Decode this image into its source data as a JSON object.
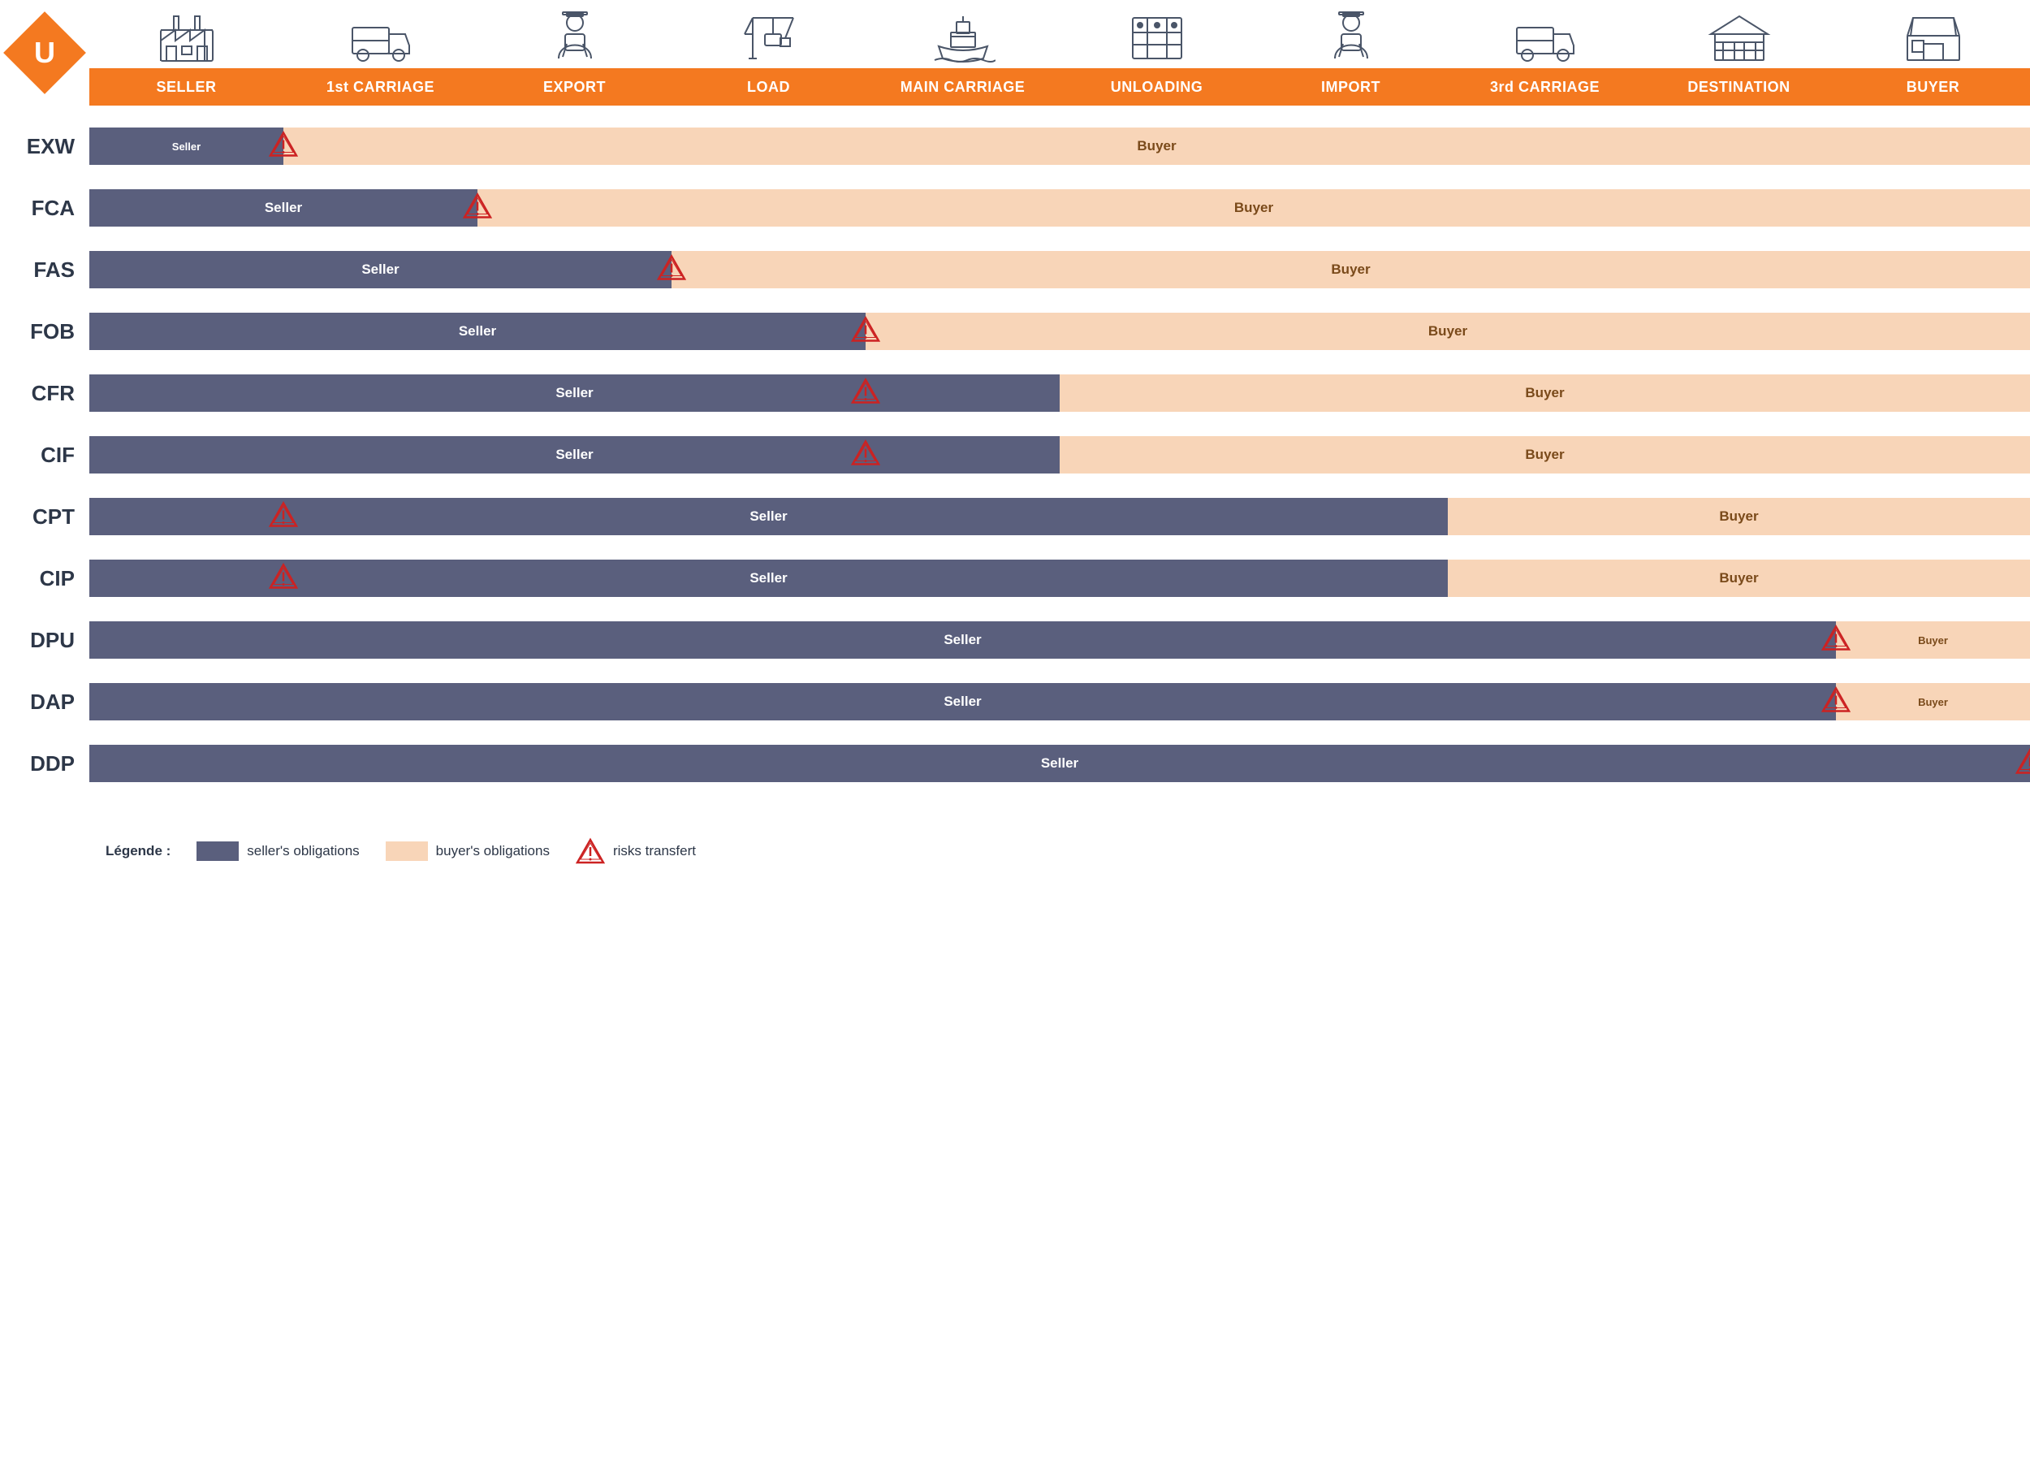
{
  "header": {
    "columns": [
      {
        "label": "SELLER",
        "icon": "factory"
      },
      {
        "label": "1st CARRIAGE",
        "icon": "truck"
      },
      {
        "label": "EXPORT",
        "icon": "person"
      },
      {
        "label": "LOAD",
        "icon": "crane"
      },
      {
        "label": "MAIN\nCARRIAGE",
        "icon": "ship"
      },
      {
        "label": "UNLOADING",
        "icon": "grid-box"
      },
      {
        "label": "IMPORT",
        "icon": "person2"
      },
      {
        "label": "3rd CARRIAGE",
        "icon": "truck2"
      },
      {
        "label": "DESTINATION",
        "icon": "warehouse"
      },
      {
        "label": "BUYER",
        "icon": "shop"
      }
    ]
  },
  "incoterms": [
    {
      "code": "EXW",
      "seller_cols": 1,
      "risk_at": 1,
      "buyer_cols": 9
    },
    {
      "code": "FCA",
      "seller_cols": 2,
      "risk_at": 2,
      "buyer_cols": 8
    },
    {
      "code": "FAS",
      "seller_cols": 3,
      "risk_at": 3,
      "buyer_cols": 7
    },
    {
      "code": "FOB",
      "seller_cols": 4,
      "risk_at": 4,
      "buyer_cols": 6
    },
    {
      "code": "CFR",
      "seller_cols": 5,
      "risk_at": 4,
      "buyer_cols": 5
    },
    {
      "code": "CIF",
      "seller_cols": 5,
      "risk_at": 4,
      "buyer_cols": 5
    },
    {
      "code": "CPT",
      "seller_cols": 7,
      "risk_at": 1,
      "buyer_cols": 3
    },
    {
      "code": "CIP",
      "seller_cols": 7,
      "risk_at": 1,
      "buyer_cols": 3
    },
    {
      "code": "DPU",
      "seller_cols": 9,
      "risk_at": 9,
      "buyer_cols": 1
    },
    {
      "code": "DAP",
      "seller_cols": 9,
      "risk_at": 9,
      "buyer_cols": 1
    },
    {
      "code": "DDP",
      "seller_cols": 10,
      "risk_at": 10,
      "buyer_cols": 0
    }
  ],
  "legend": {
    "prefix": "Légende :",
    "seller_label": "seller's obligations",
    "buyer_label": "buyer's obligations",
    "risk_label": "risks transfert"
  }
}
